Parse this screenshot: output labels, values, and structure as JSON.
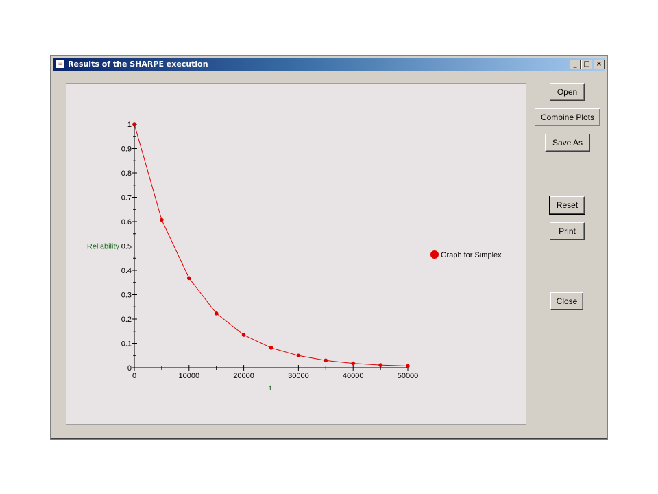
{
  "window": {
    "title": "Results of the SHARPE execution",
    "controls": {
      "minimize": "_",
      "maximize": "□",
      "close": "×"
    }
  },
  "buttons": {
    "open": "Open",
    "combine": "Combine Plots",
    "save_as": "Save As",
    "reset": "Reset",
    "print": "Print",
    "close": "Close"
  },
  "colors": {
    "series": "#e00000",
    "axis_title": "#1a6b1a",
    "plot_bg": "#e8e4e6"
  },
  "chart_data": {
    "type": "line",
    "xlabel": "t",
    "ylabel": "Reliability",
    "xlim": [
      0,
      50000
    ],
    "ylim": [
      0,
      1
    ],
    "x_ticks": [
      "0",
      "10000",
      "20000",
      "30000",
      "40000",
      "50000"
    ],
    "y_ticks": [
      "0",
      "0.1",
      "0.2",
      "0.3",
      "0.4",
      "0.5",
      "0.6",
      "0.7",
      "0.8",
      "0.9",
      "1"
    ],
    "legend_position": "right",
    "series": [
      {
        "name": "Graph for Simplex",
        "x": [
          0,
          5000,
          10000,
          15000,
          20000,
          25000,
          30000,
          35000,
          40000,
          45000,
          50000
        ],
        "y": [
          1.0,
          0.607,
          0.368,
          0.223,
          0.135,
          0.082,
          0.05,
          0.03,
          0.018,
          0.011,
          0.007
        ]
      }
    ]
  }
}
